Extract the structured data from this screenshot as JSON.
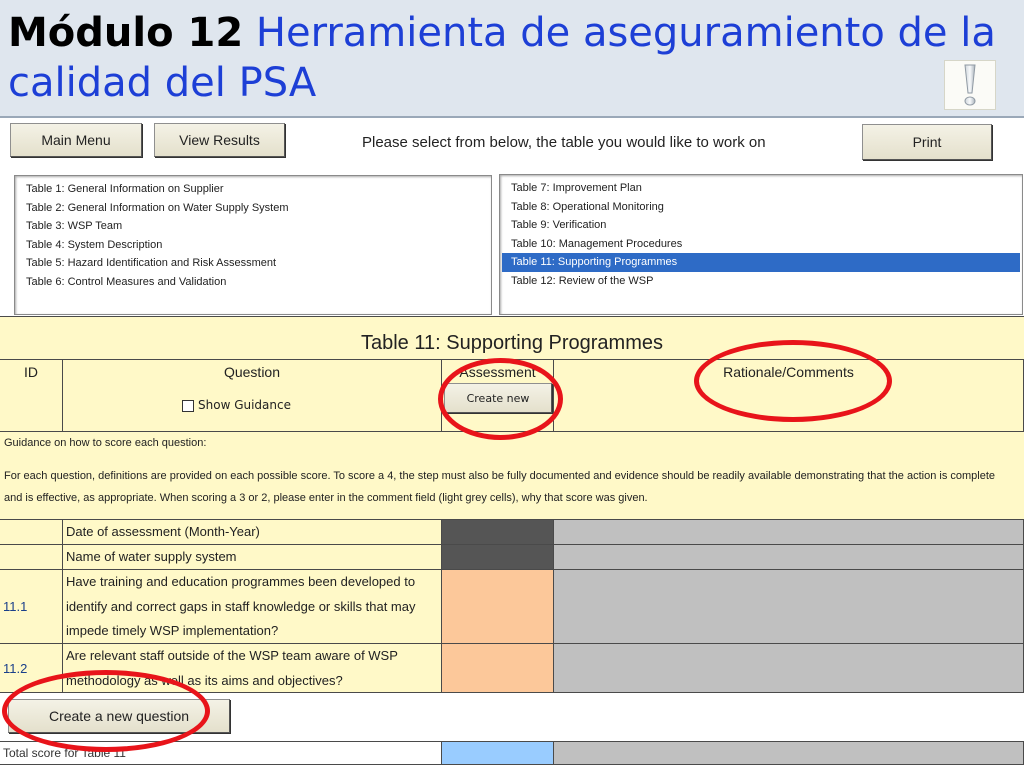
{
  "slide": {
    "title_bold": "Módulo 12",
    "title_rest": "Herramienta de aseguramiento de la calidad del PSA",
    "icon": "exclamation-icon"
  },
  "toolbar": {
    "main_menu": "Main Menu",
    "view_results": "View Results",
    "prompt": "Please select from below, the table you would like to work on",
    "print": "Print"
  },
  "tables_left": [
    "Table 1: General Information on Supplier",
    "Table 2: General Information on Water Supply System",
    "Table 3: WSP Team",
    "Table 4: System Description",
    "Table 5: Hazard Identification and Risk Assessment",
    "Table 6: Control Measures and Validation"
  ],
  "tables_right": [
    "Table 7: Improvement Plan",
    "Table 8: Operational Monitoring",
    "Table 9: Verification",
    "Table 10: Management Procedures",
    "Table 11: Supporting Programmes",
    "Table 12: Review of the WSP"
  ],
  "selected_table": "Table 11: Supporting Programmes",
  "sheet": {
    "title": "Table 11: Supporting Programmes",
    "headers": {
      "id": "ID",
      "question": "Question",
      "assessment": "Assessment",
      "comments": "Rationale/Comments"
    },
    "show_guidance": "Show Guidance",
    "create_new": "Create new",
    "guidance_title": "Guidance on how to score each question:",
    "guidance_line1": "For each question, definitions are provided on each possible score.  To score a 4, the step must also be fully documented and evidence should be readily available demonstrating that the action is complete",
    "guidance_line2": "and is effective, as appropriate.  When scoring a 3 or 2, please enter in the comment field (light grey cells), why that score was given.",
    "rows": [
      {
        "id": "",
        "question": "Date of assessment (Month-Year)"
      },
      {
        "id": "",
        "question": "Name of water supply system"
      },
      {
        "id": "11.1",
        "question": "Have training and education programmes been developed to identify and correct gaps in staff knowledge or skills that may impede timely WSP implementation?"
      },
      {
        "id": "11.2",
        "question": "Are relevant staff outside of the WSP team aware of WSP methodology as well as its aims and objectives?"
      }
    ],
    "create_question": "Create  a new question",
    "total_label": "Total score for Table 11"
  },
  "colors": {
    "highlight_red": "#e8141a",
    "cell_yellow": "#fff9c8",
    "selection_blue": "#2e6bc6",
    "title_blue": "#1d3fd6"
  }
}
